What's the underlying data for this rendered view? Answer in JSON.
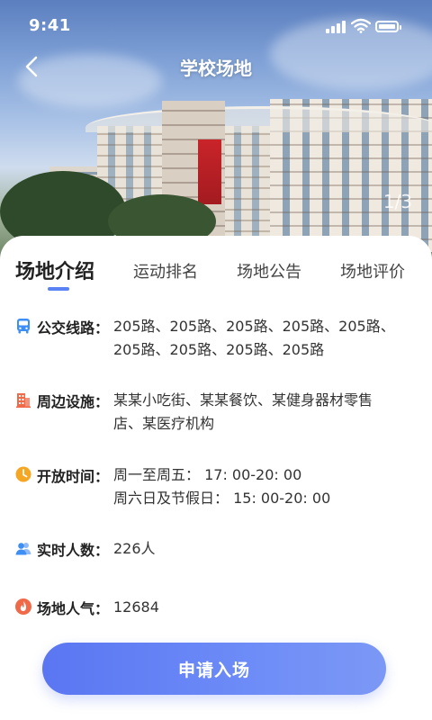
{
  "status_bar": {
    "time": "9:41"
  },
  "header": {
    "title": "学校场地",
    "image_counter": "1/3"
  },
  "tabs": [
    {
      "label": "场地介绍",
      "active": true
    },
    {
      "label": "运动排名",
      "active": false
    },
    {
      "label": "场地公告",
      "active": false
    },
    {
      "label": "场地评价",
      "active": false
    }
  ],
  "info": {
    "bus": {
      "icon": "bus-icon",
      "label": "公交线路：",
      "lines": [
        "205路、205路、205路、205路、205路、",
        "205路、205路、205路、205路"
      ]
    },
    "facilities": {
      "icon": "building-icon",
      "label": "周边设施：",
      "lines": [
        "某某小吃街、某某餐饮、某健身器材零售",
        "店、某医疗机构"
      ]
    },
    "hours": {
      "icon": "clock-icon",
      "label": "开放时间：",
      "lines": [
        "周一至周五：  17: 00-20: 00",
        "周六日及节假日：  15: 00-20: 00"
      ]
    },
    "people": {
      "icon": "users-icon",
      "label": "实时人数：",
      "lines": [
        "226人"
      ]
    },
    "popularity": {
      "icon": "fire-icon",
      "label": "场地人气：",
      "lines": [
        "12684"
      ]
    }
  },
  "action": {
    "label": "申请入场"
  },
  "colors": {
    "accent": "#5b82f5",
    "button_start": "#5a76f2",
    "button_end": "#7c98f6",
    "bus_icon": "#3d8ef5",
    "building_icon": "#f06a4a",
    "clock_icon": "#f5a623",
    "users_icon": "#3d8ef5",
    "fire_icon": "#f06a4a"
  }
}
